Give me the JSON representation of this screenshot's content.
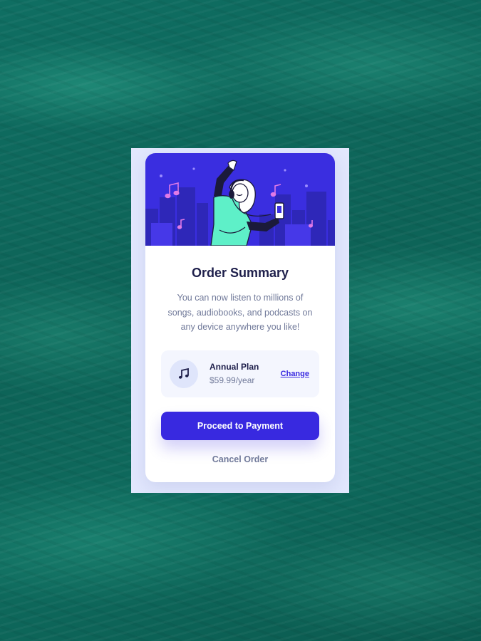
{
  "hero": {
    "illustration": "woman-dancing-with-headphones-illustration",
    "background_color": "#3a2ee0",
    "accent_color": "#5ef0c8",
    "note_color": "#e07ae6"
  },
  "summary": {
    "title": "Order Summary",
    "description": "You can now listen to millions of songs, audiobooks, and podcasts on any device anywhere you like!"
  },
  "plan": {
    "icon": "music-note-icon",
    "name": "Annual Plan",
    "price": "$59.99/year",
    "change_label": "Change"
  },
  "actions": {
    "pay_label": "Proceed to Payment",
    "cancel_label": "Cancel Order"
  },
  "colors": {
    "primary": "#3829e0",
    "heading": "#1e1f4b",
    "muted": "#717a9a",
    "frame_bg": "#e2e7fd",
    "page_bg": "#0e6a5d"
  }
}
